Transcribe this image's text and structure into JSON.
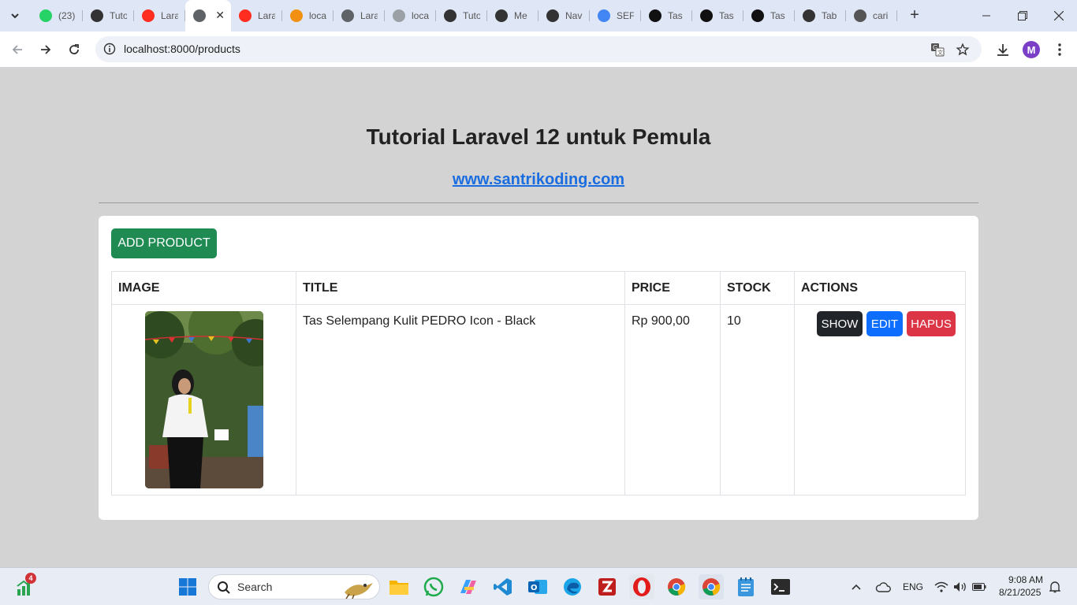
{
  "browser": {
    "tabs": [
      {
        "label": "(23)",
        "icon": "whatsapp-icon",
        "color": "#25d366"
      },
      {
        "label": "Tuto",
        "icon": "copilot-icon",
        "color": "#333333"
      },
      {
        "label": "Lara",
        "icon": "laravel-icon",
        "color": "#ff2d20"
      },
      {
        "label": "",
        "icon": "globe-icon",
        "color": "#5f6368",
        "active": true
      },
      {
        "label": "Lara",
        "icon": "laravel-icon",
        "color": "#ff2d20"
      },
      {
        "label": "loca",
        "icon": "phpmyadmin-icon",
        "color": "#f29111"
      },
      {
        "label": "Lara",
        "icon": "globe-icon",
        "color": "#5f6368"
      },
      {
        "label": "loca",
        "icon": "globe-icon",
        "color": "#9aa0a6"
      },
      {
        "label": "Tuto",
        "icon": "copilot-icon",
        "color": "#333333"
      },
      {
        "label": "Me",
        "icon": "copilot-icon",
        "color": "#333333"
      },
      {
        "label": "Nav",
        "icon": "openai-icon",
        "color": "#333333"
      },
      {
        "label": "SEF",
        "icon": "google-icon",
        "color": "#4285f4"
      },
      {
        "label": "Tas",
        "icon": "product-site-icon",
        "color": "#111111"
      },
      {
        "label": "Tas",
        "icon": "product-site-icon",
        "color": "#111111"
      },
      {
        "label": "Tas",
        "icon": "product-site-icon",
        "color": "#111111"
      },
      {
        "label": "Tab",
        "icon": "openai-icon",
        "color": "#333333"
      },
      {
        "label": "cari",
        "icon": "loading-icon",
        "color": "#555555"
      }
    ],
    "url": "localhost:8000/products",
    "profile_initial": "M"
  },
  "page": {
    "title": "Tutorial Laravel 12 untuk Pemula",
    "link": "www.santrikoding.com",
    "add_button": "ADD PRODUCT",
    "table": {
      "headers": [
        "IMAGE",
        "TITLE",
        "PRICE",
        "STOCK",
        "ACTIONS"
      ],
      "rows": [
        {
          "title": "Tas Selempang Kulit PEDRO Icon - Black",
          "price": "Rp 900,00",
          "stock": "10",
          "actions": {
            "show": "SHOW",
            "edit": "EDIT",
            "delete": "HAPUS"
          }
        }
      ]
    }
  },
  "taskbar": {
    "widget_badge": "4",
    "search_label": "Search",
    "language": "ENG",
    "time": "9:08 AM",
    "date": "8/21/2025"
  },
  "colors": {
    "add": "#1f8a52",
    "show": "#212529",
    "edit": "#0d6efd",
    "delete": "#dc3545",
    "link": "#1a6de0",
    "page_bg": "#d3d3d3"
  }
}
